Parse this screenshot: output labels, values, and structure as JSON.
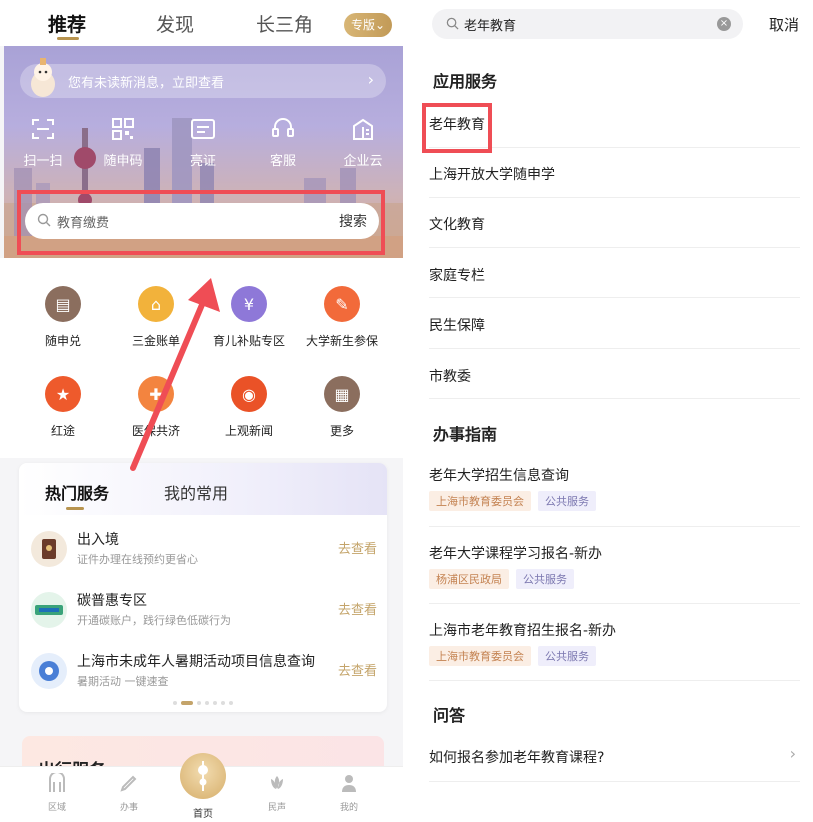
{
  "left": {
    "tabs": [
      "推荐",
      "发现",
      "长三角"
    ],
    "edition": "专版",
    "notice": "您有未读新消息，立即查看",
    "quick": [
      "扫一扫",
      "随申码",
      "亮证",
      "客服",
      "企业云"
    ],
    "search": {
      "placeholder": "教育缴费",
      "button": "搜索"
    },
    "grid": [
      {
        "label": "随申兑",
        "color": "#8b6e5e"
      },
      {
        "label": "三金账单",
        "color": "#f2b23b"
      },
      {
        "label": "育儿补贴专区",
        "color": "#8e78d8"
      },
      {
        "label": "大学新生参保",
        "color": "#f26a3a"
      },
      {
        "label": "红途",
        "color": "#ee5a2c"
      },
      {
        "label": "医保共济",
        "color": "#f3843f"
      },
      {
        "label": "上观新闻",
        "color": "#ea5227"
      },
      {
        "label": "更多",
        "color": "#8b6e5e"
      }
    ],
    "card": {
      "tabs": [
        "热门服务",
        "我的常用"
      ],
      "items": [
        {
          "title": "出入境",
          "sub": "证件办理在线预约更省心",
          "action": "去查看",
          "color": "#6b3b2a"
        },
        {
          "title": "碳普惠专区",
          "sub": "开通碳账户，践行绿色低碳行为",
          "action": "去查看",
          "color": "#3aa37a"
        },
        {
          "title": "上海市未成年人暑期活动项目信息查询",
          "sub": "暑期活动 一键速查",
          "action": "去查看",
          "color": "#4a7fd6"
        }
      ],
      "dots": 7,
      "active_dot": 1
    },
    "trip_title": "出行服务",
    "bottom_nav": [
      "区域",
      "办事",
      "首页",
      "民声",
      "我的"
    ]
  },
  "right": {
    "search_value": "老年教育",
    "cancel": "取消",
    "sections": {
      "apps": "应用服务",
      "guide": "办事指南",
      "qa": "问答"
    },
    "app_items": [
      "老年教育",
      "上海开放大学随申学",
      "文化教育",
      "家庭专栏",
      "民生保障",
      "市教委"
    ],
    "guide_items": [
      {
        "title": "老年大学招生信息查询",
        "tags": [
          "上海市教育委员会",
          "公共服务"
        ]
      },
      {
        "title": "老年大学课程学习报名-新办",
        "tags": [
          "杨浦区民政局",
          "公共服务"
        ]
      },
      {
        "title": "上海市老年教育招生报名-新办",
        "tags": [
          "上海市教育委员会",
          "公共服务"
        ]
      }
    ],
    "qa_items": [
      "如何报名参加老年教育课程?"
    ]
  },
  "colors": {
    "gold": "#c4a46a",
    "highlight": "#ef4d55"
  }
}
